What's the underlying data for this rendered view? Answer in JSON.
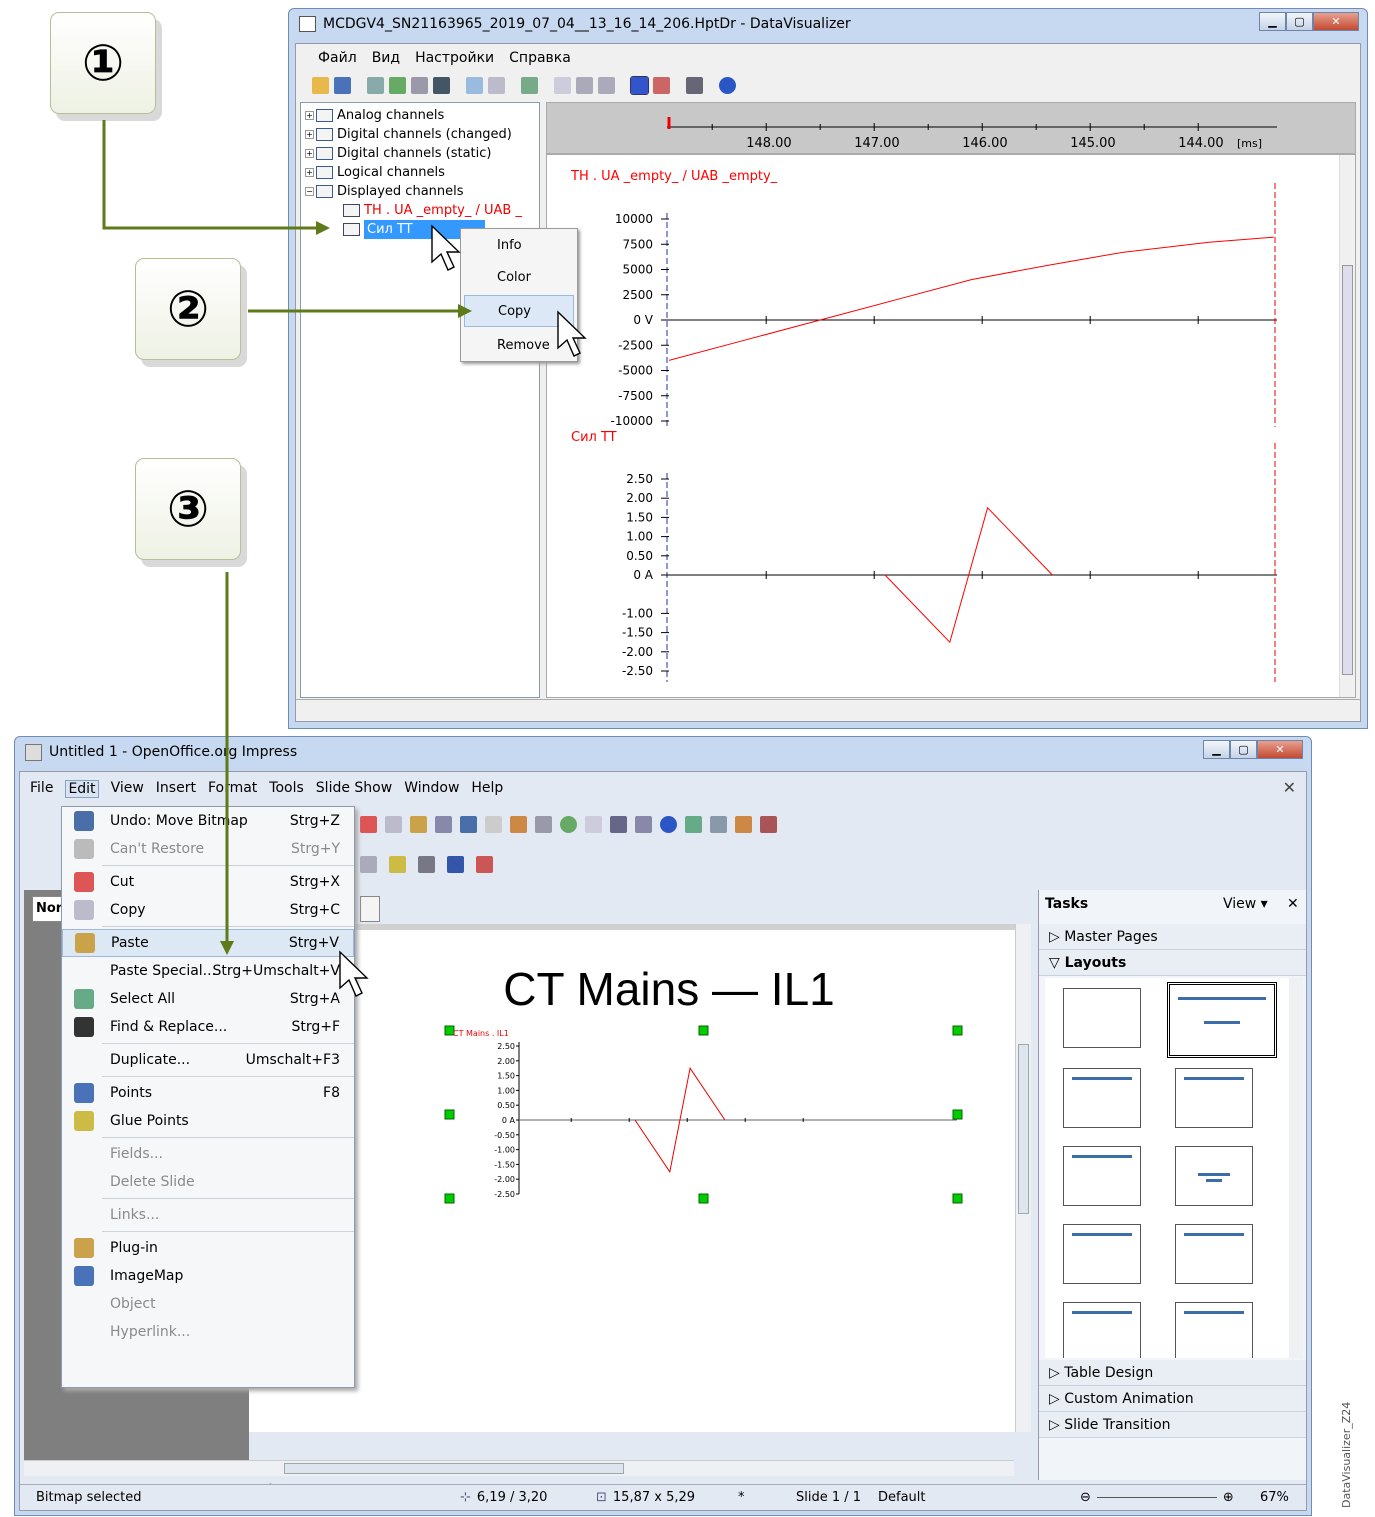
{
  "steps": {
    "one": "①",
    "two": "②",
    "three": "③"
  },
  "dv": {
    "title": "MCDGV4_SN21163965_2019_07_04__13_16_14_206.HptDr - DataVisualizer",
    "menu": [
      "Файл",
      "Вид",
      "Настройки",
      "Справка"
    ],
    "tree": [
      "Analog channels",
      "Digital channels (changed)",
      "Digital channels (static)",
      "Logical channels",
      "Displayed channels",
      "TH . UA _empty_ / UAB _",
      "Сил TT"
    ],
    "context_menu": [
      "Info",
      "Color",
      "Copy",
      "Remove"
    ],
    "time_axis": {
      "ticks": [
        "148.00",
        "147.00",
        "146.00",
        "145.00",
        "144.00"
      ],
      "unit": "[ms]"
    }
  },
  "chart_data": [
    {
      "type": "line",
      "title": "TH . UA _empty_ / UAB _empty_",
      "y_ticks": [
        "10000",
        "7500",
        "5000",
        "2500",
        "0 V",
        "-2500",
        "-5000",
        "-7500",
        "-10000"
      ],
      "ylim": [
        -10000,
        10000
      ],
      "xlim": [
        148.9,
        143.3
      ],
      "series": [
        {
          "name": "TH . UA _empty_ / UAB _empty_",
          "x": [
            148.9,
            148.2,
            147.5,
            146.8,
            146.1,
            145.4,
            144.7,
            143.9,
            143.3
          ],
          "y": [
            -4000,
            -2000,
            0,
            2000,
            4000,
            5400,
            6700,
            7700,
            8200
          ]
        }
      ],
      "color": "#ff0000"
    },
    {
      "type": "line",
      "title": "Сил TT",
      "y_ticks": [
        "2.50",
        "2.00",
        "1.50",
        "1.00",
        "0.50",
        "0 A",
        "-1.00",
        "-1.50",
        "-2.00",
        "-2.50"
      ],
      "ylim": [
        -2.5,
        2.5
      ],
      "xlim": [
        148.9,
        143.3
      ],
      "series": [
        {
          "name": "Сил TT",
          "x": [
            146.9,
            146.3,
            145.95,
            145.35
          ],
          "y": [
            0,
            -1.75,
            1.75,
            0
          ]
        }
      ],
      "color": "#ff0000"
    }
  ],
  "oo": {
    "title": "Untitled 1 - OpenOffice.org Impress",
    "menu": [
      "File",
      "Edit",
      "View",
      "Insert",
      "Format",
      "Tools",
      "Slide Show",
      "Window",
      "Help"
    ],
    "view_tab": "Nor",
    "slide_title": "CT Mains — IL1",
    "pasted_chart": {
      "label": "CT Mains . IL1",
      "ticks": [
        "2.50",
        "2.00",
        "1.50",
        "1.00",
        "0.50",
        "0 A",
        "-0.50",
        "-1.00",
        "-1.50",
        "-2.00",
        "-2.50"
      ]
    },
    "edit_menu": [
      {
        "label": "Undo: Move Bitmap",
        "key": "Strg+Z",
        "disabled": false
      },
      {
        "label": "Can't Restore",
        "key": "Strg+Y",
        "disabled": true
      },
      {
        "label": "Cut",
        "key": "Strg+X",
        "disabled": false
      },
      {
        "label": "Copy",
        "key": "Strg+C",
        "disabled": false
      },
      {
        "label": "Paste",
        "key": "Strg+V",
        "disabled": false
      },
      {
        "label": "Paste Special...",
        "key": "Strg+Umschalt+V",
        "disabled": false
      },
      {
        "label": "Select All",
        "key": "Strg+A",
        "disabled": false
      },
      {
        "label": "Find & Replace...",
        "key": "Strg+F",
        "disabled": false
      },
      {
        "label": "Duplicate...",
        "key": "Umschalt+F3",
        "disabled": false
      },
      {
        "label": "Points",
        "key": "F8",
        "disabled": false
      },
      {
        "label": "Glue Points",
        "key": "",
        "disabled": false
      },
      {
        "label": "Fields...",
        "key": "",
        "disabled": true
      },
      {
        "label": "Delete Slide",
        "key": "",
        "disabled": true
      },
      {
        "label": "Links...",
        "key": "",
        "disabled": true
      },
      {
        "label": "Plug-in",
        "key": "",
        "disabled": false
      },
      {
        "label": "ImageMap",
        "key": "",
        "disabled": false
      },
      {
        "label": "Object",
        "key": "",
        "disabled": true
      },
      {
        "label": "Hyperlink...",
        "key": "",
        "disabled": true
      }
    ],
    "tasks": {
      "title": "Tasks",
      "view": "View",
      "sections": [
        "Master Pages",
        "Layouts",
        "Table Design",
        "Custom Animation",
        "Slide Transition"
      ]
    },
    "status": {
      "selection": "Bitmap selected",
      "position": "6,19 / 3,20",
      "size": "15,87 x 5,29",
      "modified": "*",
      "slide": "Slide 1 / 1",
      "master": "Default",
      "zoom": "67%"
    }
  },
  "watermark": "DataVisualizer_Z24"
}
